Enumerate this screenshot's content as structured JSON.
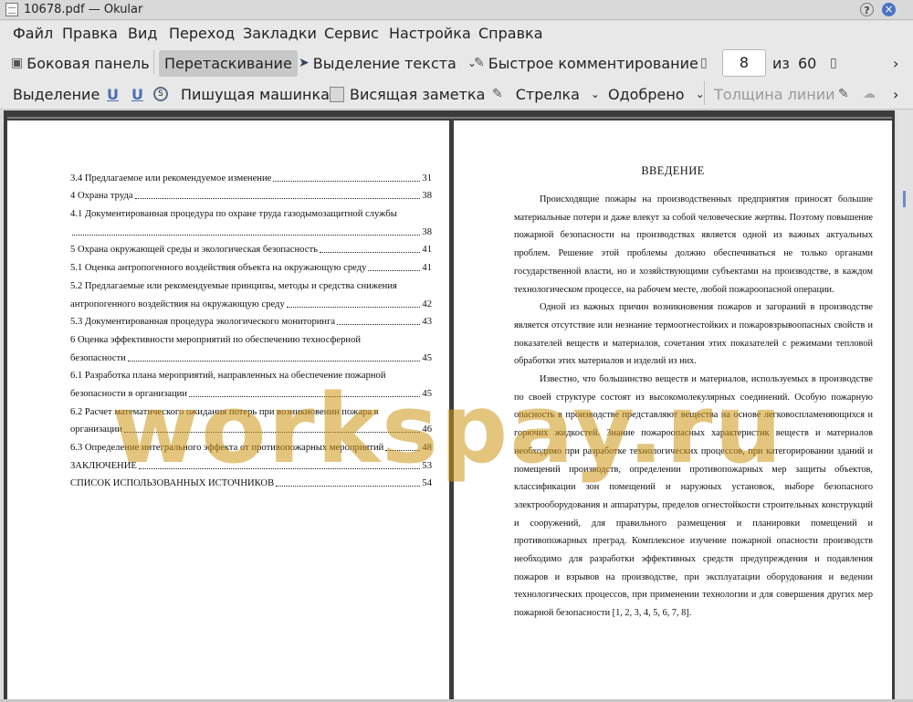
{
  "window": {
    "title": "10678.pdf  — Okular"
  },
  "menu": [
    "Файл",
    "Правка",
    "Вид",
    "Переход",
    "Закладки",
    "Сервис",
    "Настройка",
    "Справка"
  ],
  "toolbar1": {
    "sidebar": "Боковая панель",
    "browse": "Перетаскивание",
    "text_select": "Выделение текста",
    "quick_annot": "Быстрое комментирование",
    "page_current": "8",
    "page_of": "из",
    "page_total": "60",
    "more": "›"
  },
  "toolbar2": {
    "highlight": "Выделение",
    "underline1": "U",
    "underline2": "U",
    "typewriter": "Пишущая машинка",
    "popup_note": "Висящая заметка",
    "arrow": "Стрелка",
    "approved": "Одобрено",
    "line_width": "Толщина линии",
    "more": "›"
  },
  "icons": {
    "app": "okular-icon",
    "help": "?",
    "close": "×",
    "chevron": "⌄"
  },
  "colors": {
    "accent": "#4a72c3",
    "watermark": "#d29a14"
  },
  "left_page": {
    "toc": [
      {
        "t": "3.4 Предлагаемое или рекомендуемое изменение",
        "p": "31"
      },
      {
        "t": "4 Охрана труда",
        "p": "38"
      },
      {
        "t": "4.1 Документированная процедура по охране труда газодымозащитной службы",
        "p": ""
      },
      {
        "t": "",
        "p": "38"
      },
      {
        "t": "5 Охрана окружающей среды и экологическая безопасность",
        "p": "41"
      },
      {
        "t": "5.1 Оценка антропогенного воздействия объекта на окружающую среду",
        "p": "41"
      },
      {
        "t": "5.2 Предлагаемые или рекомендуемые принципы, методы и средства снижения",
        "p": ""
      },
      {
        "t": "антропогенного воздействия на окружающую среду",
        "p": "42"
      },
      {
        "t": "5.3 Документированная процедура экологического мониторинга",
        "p": "43"
      },
      {
        "t": "6 Оценка эффективности мероприятий по обеспечению техносферной",
        "p": ""
      },
      {
        "t": "безопасности",
        "p": "45"
      },
      {
        "t": "6.1 Разработка плана мероприятий, направленных на обеспечение пожарной",
        "p": ""
      },
      {
        "t": "безопасности в организации",
        "p": "45"
      },
      {
        "t": "6.2 Расчет математического ожидания потерь при возникновении пожара в",
        "p": ""
      },
      {
        "t": "организации",
        "p": "46"
      },
      {
        "t": "6.3 Определение интегрального эффекта от противопожарных мероприятий",
        "p": "48"
      },
      {
        "t": "ЗАКЛЮЧЕНИЕ",
        "p": "53"
      },
      {
        "t": "СПИСОК ИСПОЛЬЗОВАННЫХ ИСТОЧНИКОВ",
        "p": "54"
      }
    ]
  },
  "right_page": {
    "heading": "ВВЕДЕНИЕ",
    "paragraphs": [
      "Происходящие пожары на производственных предприятия приносят большие материальные потери и даже влекут за собой человеческие жертвы. Поэтому повышение пожарной безопасности на производствах является одной из важных актуальных проблем. Решение этой проблемы должно обеспечиваться не только органами государственной власти, но и хозяйствующими субъектами на производстве, в каждом технологическом процессе, на рабочем месте, любой пожароопасной операции.",
      "Одной из важных причин возникновения пожаров и загораний в производстве является отсутствие или незнание термоогнестойких и пожаровзрывоопасных свойств и показателей веществ и материалов, сочетания этих показателей с режимами тепловой обработки этих материалов и изделий из них.",
      "Известно, что большинство веществ и материалов, используемых в производстве по своей структуре состоят из высокомолекулярных соединений. Особую пожарную опасность в производстве представляют вещества на основе легковоспламеняющихся и горючих жидкостей. Знание пожароопасных характеристик веществ и материалов необходимо при разработке технологических процессов, при категорировании зданий и помещений производств, определении противопожарных мер защиты объектов, классификации зон помещений и наружных установок, выборе безопасного электрооборудования и аппаратуры, пределов огнестойкости строительных конструкций и сооружений, для правильного размещения и планировки помещений и противопожарных преград. Комплексное изучение пожарной опасности производств необходимо для разработки эффективных средств предупреждения и подавления пожаров и взрывов на производстве, при эксплуатации оборудования и ведении технологических процессов, при применении технологии и для совершения других мер пожарной безопасности [1, 2, 3, 4, 5, 6, 7, 8]."
    ]
  },
  "watermark": "workspay.ru"
}
